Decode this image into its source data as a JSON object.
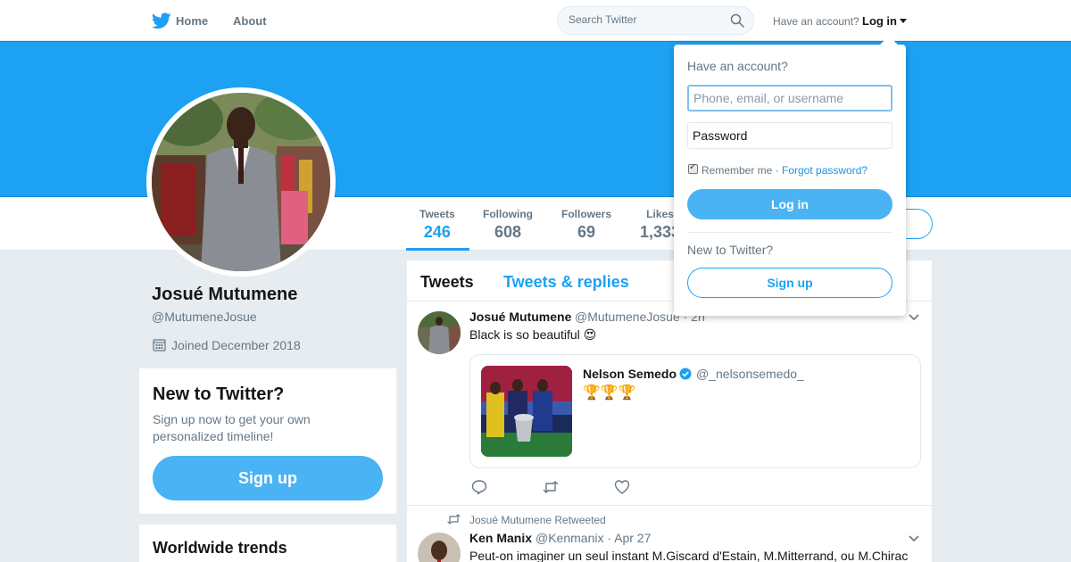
{
  "nav": {
    "home_label": "Home",
    "about_label": "About",
    "search_placeholder": "Search Twitter",
    "have_account_label": "Have an account?",
    "login_label": "Log in",
    "brand_color": "#1da1f2"
  },
  "profile": {
    "full_name": "Josué Mutumene",
    "screen_name": "@MutumeneJosue",
    "joined": "Joined December 2018",
    "stats": [
      {
        "label": "Tweets",
        "value": "246",
        "active": true
      },
      {
        "label": "Following",
        "value": "608",
        "active": false
      },
      {
        "label": "Followers",
        "value": "69",
        "active": false
      },
      {
        "label": "Likes",
        "value": "1,333",
        "active": false
      }
    ]
  },
  "signup_card": {
    "title": "New to Twitter?",
    "text": "Sign up now to get your own personalized timeline!",
    "button_label": "Sign up"
  },
  "trends": {
    "title": "Worldwide trends"
  },
  "timeline": {
    "tabs": [
      {
        "label": "Tweets",
        "active": true
      },
      {
        "label": "Tweets & replies",
        "active": false
      }
    ],
    "tweets": [
      {
        "name": "Josué Mutumene",
        "handle": "@MutumeneJosue · 2h",
        "text": "Black is so beautiful 😍",
        "quote": {
          "name": "Nelson Semedo",
          "handle": "@_nelsonsemedo_",
          "text": "🏆🏆🏆"
        },
        "actions": [
          "reply-icon",
          "retweet-icon",
          "like-icon"
        ]
      },
      {
        "retweet_context": "Josué Mutumene Retweeted",
        "name": "Ken Manix",
        "handle": "@Kenmanix · Apr 27",
        "text": "Peut-on imaginer un seul instant M.Giscard d'Estain, M.Mitterrand, ou M.Chirac"
      }
    ]
  },
  "login_dropdown": {
    "heading": "Have an account?",
    "username_placeholder": "Phone, email, or username",
    "password_placeholder": "Password",
    "remember_label": "Remember me ·",
    "forgot_label": "Forgot password?",
    "login_button": "Log in",
    "new_label": "New to Twitter?",
    "signup_button": "Sign up"
  }
}
